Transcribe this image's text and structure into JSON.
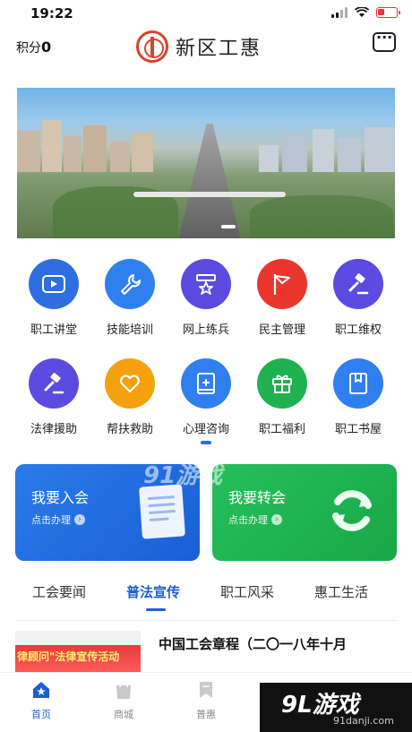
{
  "status_bar": {
    "time": "19:22"
  },
  "header": {
    "points_label": "积分",
    "points_value": "0",
    "title": "新区工惠"
  },
  "services": [
    {
      "label": "职工讲堂",
      "icon": "video-play-icon",
      "color": "#2f6ee0"
    },
    {
      "label": "技能培训",
      "icon": "wrench-icon",
      "color": "#2f80ee"
    },
    {
      "label": "网上练兵",
      "icon": "star-badge-icon",
      "color": "#5b4be0"
    },
    {
      "label": "民主管理",
      "icon": "flag-icon",
      "color": "#e8362c"
    },
    {
      "label": "职工维权",
      "icon": "gavel-icon",
      "color": "#5b4be0"
    },
    {
      "label": "法律援助",
      "icon": "gavel-icon",
      "color": "#5b4be0"
    },
    {
      "label": "帮扶救助",
      "icon": "heart-icon",
      "color": "#f5a10f"
    },
    {
      "label": "心理咨询",
      "icon": "book-plus-icon",
      "color": "#2f80ee"
    },
    {
      "label": "职工福利",
      "icon": "gift-icon",
      "color": "#1fb14f"
    },
    {
      "label": "职工书屋",
      "icon": "bookmark-book-icon",
      "color": "#2f80ee"
    }
  ],
  "cards": [
    {
      "title": "我要入会",
      "subtitle": "点击办理"
    },
    {
      "title": "我要转会",
      "subtitle": "点击办理"
    }
  ],
  "watermark": "91游戏",
  "tabs": [
    {
      "label": "工会要闻"
    },
    {
      "label": "普法宣传"
    },
    {
      "label": "职工风采"
    },
    {
      "label": "惠工生活"
    }
  ],
  "active_tab": "普法宣传",
  "news": {
    "thumb_text": "律顾问\"法律宣传活动",
    "title": "中国工会章程（二〇一八年十月"
  },
  "bottom_nav": [
    {
      "label": "首页"
    },
    {
      "label": "商城"
    },
    {
      "label": "普惠"
    }
  ],
  "corner_logo": {
    "name": "9L游戏",
    "domain": "91danji.com"
  }
}
